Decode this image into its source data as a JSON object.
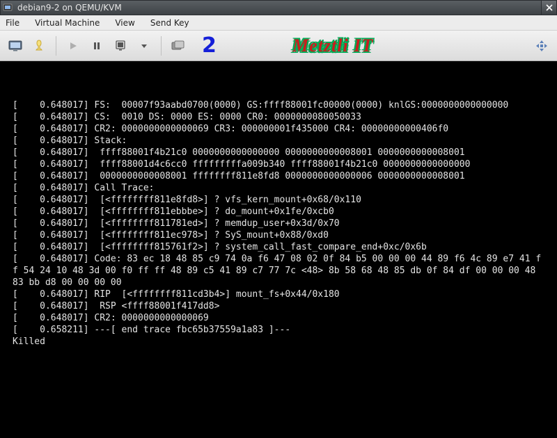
{
  "window": {
    "title": "debian9-2 on QEMU/KVM"
  },
  "menu": {
    "file": "File",
    "vm": "Virtual Machine",
    "view": "View",
    "sendkey": "Send Key"
  },
  "toolbar": {
    "number_label": "2",
    "brand": "Metztli IT"
  },
  "terminal": {
    "lines": [
      "[    0.648017] FS:  00007f93aabd0700(0000) GS:ffff88001fc00000(0000) knlGS:0000000000000000",
      "[    0.648017] CS:  0010 DS: 0000 ES: 0000 CR0: 0000000080050033",
      "[    0.648017] CR2: 0000000000000069 CR3: 000000001f435000 CR4: 00000000000406f0",
      "[    0.648017] Stack:",
      "[    0.648017]  ffff88001f4b21c0 0000000000000000 0000000000008001 0000000000008001",
      "[    0.648017]  ffff88001d4c6cc0 fffffffffa009b340 ffff88001f4b21c0 0000000000000000",
      "[    0.648017]  0000000000008001 ffffffff811e8fd8 0000000000000006 0000000000008001",
      "[    0.648017] Call Trace:",
      "[    0.648017]  [<ffffffff811e8fd8>] ? vfs_kern_mount+0x68/0x110",
      "[    0.648017]  [<ffffffff811ebbbe>] ? do_mount+0x1fe/0xcb0",
      "[    0.648017]  [<ffffffff811781ed>] ? memdup_user+0x3d/0x70",
      "[    0.648017]  [<ffffffff811ec978>] ? SyS_mount+0x88/0xd0",
      "[    0.648017]  [<ffffffff815761f2>] ? system_call_fast_compare_end+0xc/0x6b",
      "[    0.648017] Code: 83 ec 18 48 85 c9 74 0a f6 47 08 02 0f 84 b5 00 00 00 44 89 f6 4c 89 e7 41 ff 54 24 10 48 3d 00 f0 ff ff 48 89 c5 41 89 c7 77 7c <48> 8b 58 68 48 85 db 0f 84 df 00 00 00 48 83 bb d8 00 00 00 00",
      "[    0.648017] RIP  [<ffffffff811cd3b4>] mount_fs+0x44/0x180",
      "[    0.648017]  RSP <ffff88001f417dd8>",
      "[    0.648017] CR2: 0000000000000069",
      "[    0.658211] ---[ end trace fbc65b37559a1a83 ]---",
      "Killed"
    ]
  }
}
